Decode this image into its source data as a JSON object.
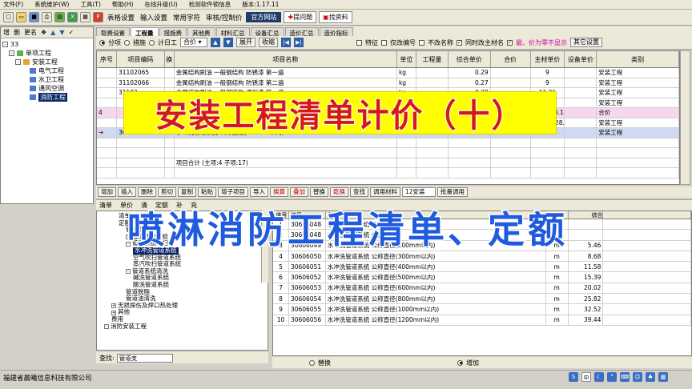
{
  "menubar": [
    "文件(F)",
    "系统维护(W)",
    "工具(T)",
    "帮助(H)",
    "在线升级(U)",
    "检测软件锁信息",
    "版本:1.17.11"
  ],
  "toolbar": {
    "items": [
      "表格设置",
      "输入设置",
      "常用字符",
      "审核/控制价"
    ],
    "dark_label": "官方网站",
    "btn1": "提问题",
    "btn2": "找资料"
  },
  "left_panel": {
    "header": [
      "增",
      "删",
      "更名",
      "❖",
      "▲",
      "▼",
      "✓"
    ],
    "root": "33",
    "items": [
      "单项工程",
      "安装工程",
      "电气工程",
      "水卫工程",
      "通风空调",
      "消防工程"
    ]
  },
  "tabs": [
    "取费设置",
    "工程量",
    "措施费",
    "其他费",
    "材料汇总",
    "设备汇总",
    "造价汇总",
    "造价指标"
  ],
  "options": {
    "radio": [
      "分项",
      "措施",
      "计日工"
    ],
    "select": "合价",
    "btn_expand": "展开",
    "btn_collapse": "收缩",
    "checks": [
      "特征",
      "仅改编号",
      "不改名称",
      "同时改主材名"
    ],
    "hint": "最、价为零不显示",
    "other": "其它设置"
  },
  "grid": {
    "headers": [
      "序号",
      "项目编码",
      "换",
      "项目名称",
      "单位",
      "工程量",
      "综合单价",
      "合价",
      "主材单价",
      "设备单价",
      "类别"
    ],
    "rows": [
      {
        "no": "",
        "code": "31102065",
        "name": "金属结构刷油 一般钢结构 防锈漆 第一遍",
        "unit": "kg",
        "qty": "",
        "price": "0.29",
        "total": "",
        "mat": "9",
        "equip": "",
        "cat": "安装工程",
        "style": ""
      },
      {
        "no": "",
        "code": "31102066",
        "name": "金属结构刷油 一般钢结构 防锈漆 第二遍",
        "unit": "kg",
        "qty": "",
        "price": "0.27",
        "total": "",
        "mat": "9",
        "equip": "",
        "cat": "安装工程",
        "style": ""
      },
      {
        "no": "",
        "code": "31102",
        "name": "金属结构刷油 一般钢结构 调和漆 第一遍",
        "unit": "kg",
        "qty": "",
        "price": "0.28",
        "total": "",
        "mat": "11.26",
        "equip": "",
        "cat": "安装工程",
        "style": ""
      },
      {
        "no": "",
        "code": "",
        "name": "",
        "unit": "",
        "qty": "",
        "price": "0.",
        "total": "",
        "mat": "11.26",
        "equip": "",
        "cat": "安装工程",
        "style": ""
      },
      {
        "no": "4",
        "code": "",
        "name": "",
        "unit": "",
        "qty": "",
        "price": "",
        "total": "",
        "mat": "14.68,28.1",
        "equip": "",
        "cat": "合价",
        "style": "pink"
      },
      {
        "no": "",
        "code": "",
        "name": "",
        "unit": "",
        "qty": "",
        "price": "111.21",
        "total": "",
        "mat": "7,14.68,28.",
        "equip": "",
        "cat": "安装工程",
        "style": ""
      },
      {
        "no": "➜",
        "code": "30606048",
        "name": "水冲洗管道系统 公称直径(100mm以内)",
        "unit": "m",
        "qty": "",
        "price": "3.55",
        "total": "",
        "mat": "2.3",
        "equip": "",
        "cat": "安装工程",
        "style": "blue"
      },
      {
        "no": "",
        "code": "",
        "name": "",
        "unit": "",
        "qty": "",
        "price": "",
        "total": "",
        "mat": "",
        "equip": "",
        "cat": "",
        "style": ""
      },
      {
        "no": "",
        "code": "",
        "name": "",
        "unit": "",
        "qty": "",
        "price": "",
        "total": "",
        "mat": "",
        "equip": "",
        "cat": "",
        "style": ""
      },
      {
        "no": "",
        "code": "",
        "name": "项目合计 (主项:4 子项:17)",
        "unit": "",
        "qty": "",
        "price": "",
        "total": "",
        "mat": "",
        "equip": "",
        "cat": "",
        "style": ""
      }
    ]
  },
  "actions": [
    "增加",
    "插入",
    "删除",
    "剪切",
    "复制",
    "粘贴",
    "增子项目",
    "导入",
    "换算",
    "叠加",
    "替换",
    "乾换",
    "查找",
    "调用材料",
    "12安装",
    "批量调用"
  ],
  "lower_tabs": [
    "清单",
    "单价",
    "清",
    "定额",
    "补",
    "充"
  ],
  "lower_tree": [
    {
      "indent": 3,
      "exp": "",
      "label": "清单",
      "sel": false
    },
    {
      "indent": 3,
      "exp": "",
      "label": "定额",
      "sel": false
    },
    {
      "indent": 4,
      "exp": "",
      "label": "管道套",
      "sel": false
    },
    {
      "indent": 4,
      "exp": "-",
      "label": "管道压力试验",
      "sel": false
    },
    {
      "indent": 4,
      "exp": "-",
      "label": "管道系统吹扫",
      "sel": false
    },
    {
      "indent": 5,
      "exp": "",
      "label": "水冲洗管道系统",
      "sel": true
    },
    {
      "indent": 5,
      "exp": "",
      "label": "空气吹扫管道系统",
      "sel": false
    },
    {
      "indent": 5,
      "exp": "",
      "label": "蒸汽吹扫管道系统",
      "sel": false
    },
    {
      "indent": 4,
      "exp": "-",
      "label": "管道系统清洗",
      "sel": false
    },
    {
      "indent": 5,
      "exp": "",
      "label": "碱洗管道系统",
      "sel": false
    },
    {
      "indent": 5,
      "exp": "",
      "label": "酸洗管道系统",
      "sel": false
    },
    {
      "indent": 4,
      "exp": "",
      "label": "管道脱脂",
      "sel": false
    },
    {
      "indent": 4,
      "exp": "",
      "label": "管道油清洗",
      "sel": false
    },
    {
      "indent": 2,
      "exp": "+",
      "label": "无损探伤及焊口热处理",
      "sel": false
    },
    {
      "indent": 2,
      "exp": "+",
      "label": "其他",
      "sel": false
    },
    {
      "indent": 2,
      "exp": "",
      "label": "费用",
      "sel": false
    },
    {
      "indent": 1,
      "exp": "-",
      "label": "消防安装工程",
      "sel": false
    }
  ],
  "search": {
    "label": "查找:",
    "value": "管道支"
  },
  "lower_grid": {
    "headers": [
      "序号",
      "编号",
      "名称",
      "单位",
      "综合"
    ],
    "rows": [
      {
        "no": "1",
        "code": "30606048",
        "name": "水冲洗管道系统 公称直径",
        "unit": "",
        "val": ""
      },
      {
        "no": "2",
        "code": "30606048",
        "name": "水冲洗管道系统 公称直径",
        "unit": "",
        "val": ""
      },
      {
        "no": "3",
        "code": "30606049",
        "name": "水冲洗管道系统 公称直径(200mm以内)",
        "unit": "m",
        "val": "5.46"
      },
      {
        "no": "4",
        "code": "30606050",
        "name": "水冲洗管道系统 公称直径(300mm以内)",
        "unit": "m",
        "val": "8.68"
      },
      {
        "no": "5",
        "code": "30606051",
        "name": "水冲洗管道系统 公称直径(400mm以内)",
        "unit": "m",
        "val": "11.58"
      },
      {
        "no": "6",
        "code": "30606052",
        "name": "水冲洗管道系统 公称直径(500mm以内)",
        "unit": "m",
        "val": "15.39"
      },
      {
        "no": "7",
        "code": "30606053",
        "name": "水冲洗管道系统 公称直径(600mm以内)",
        "unit": "m",
        "val": "20.02"
      },
      {
        "no": "8",
        "code": "30606054",
        "name": "水冲洗管道系统 公称直径(800mm以内)",
        "unit": "m",
        "val": "25.82"
      },
      {
        "no": "9",
        "code": "30606055",
        "name": "水冲洗管道系统 公称直径(1000mm以内)",
        "unit": "m",
        "val": "32.52"
      },
      {
        "no": "10",
        "code": "30606056",
        "name": "水冲洗管道系统 公称直径(1200mm以内)",
        "unit": "m",
        "val": "39.44"
      }
    ]
  },
  "replace_bar": {
    "opt1": "替换",
    "opt2": "增加"
  },
  "status": "福建省晨曦信息科技有限公司",
  "overlay_title": "安装工程清单计价（十）",
  "overlay_subtitle": "喷淋消防工程清单、定额",
  "colors": {
    "overlay_bg": "#ffff00",
    "overlay_red": "#d21a1a",
    "overlay_blue": "#1f5bdc",
    "selection": "#0a246a"
  }
}
